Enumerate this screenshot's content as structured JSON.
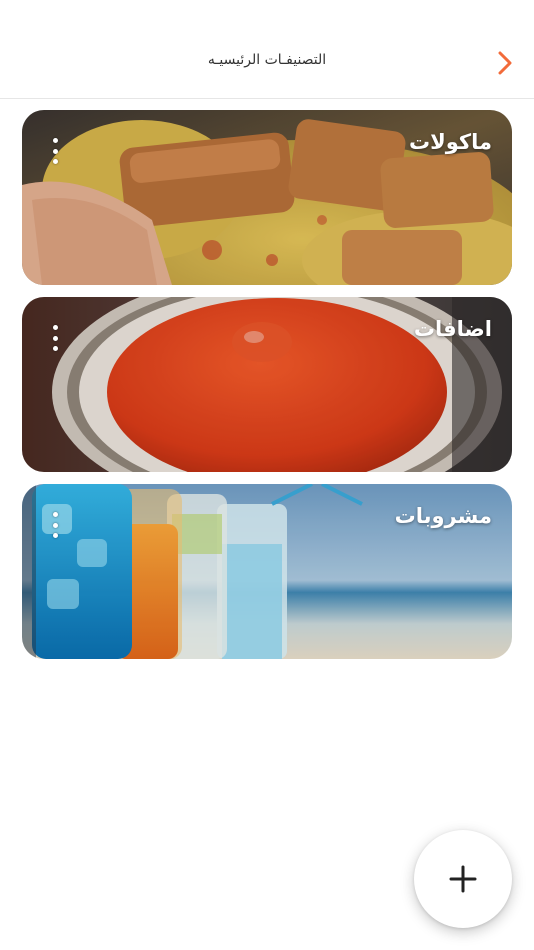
{
  "header": {
    "title": "التصنيفـات الرئيسيـه",
    "back_icon": "chevron-right-icon",
    "accent_color": "#f26b3a"
  },
  "categories": [
    {
      "label": "ماكولات",
      "image": "food-rice-chicken",
      "menu_icon": "more-vertical-icon"
    },
    {
      "label": "اضافات",
      "image": "sauce-bowl",
      "menu_icon": "more-vertical-icon"
    },
    {
      "label": "مشروبات",
      "image": "drinks-beach",
      "menu_icon": "more-vertical-icon"
    }
  ],
  "fab": {
    "icon": "plus-icon"
  }
}
